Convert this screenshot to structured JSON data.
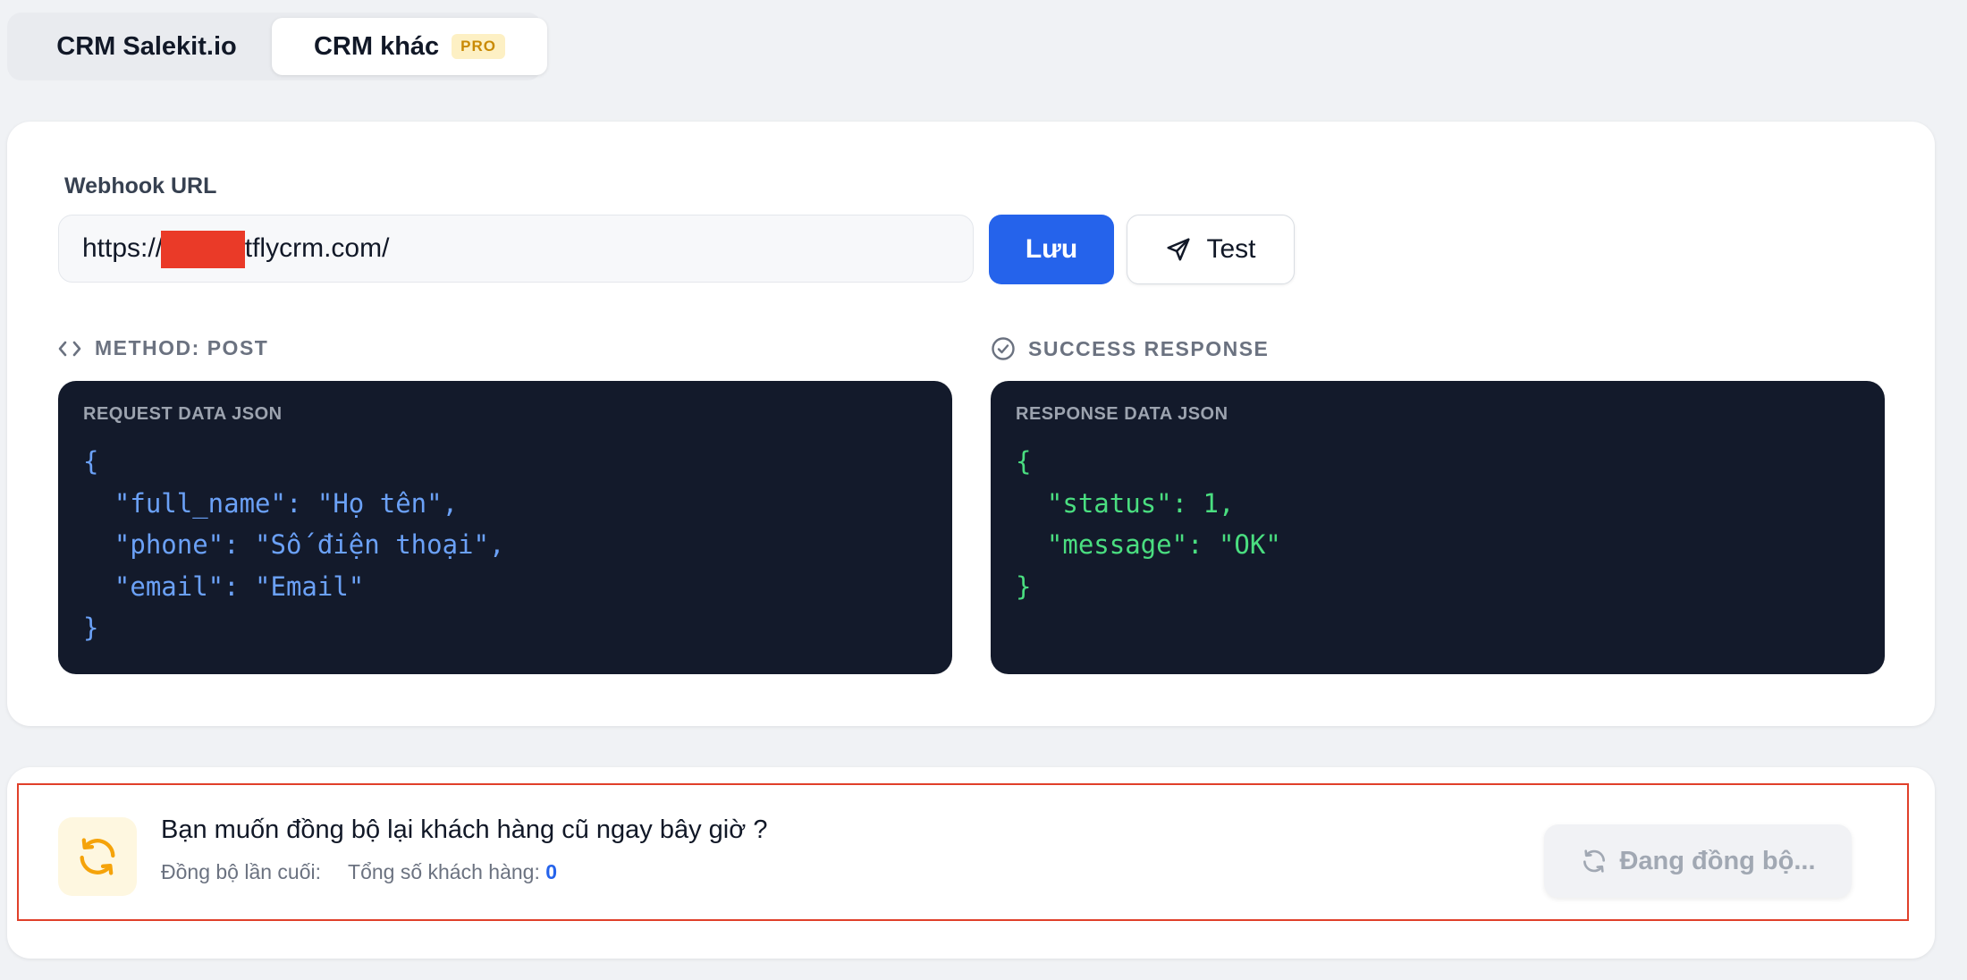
{
  "tabs": [
    {
      "label": "CRM Salekit.io",
      "active": false
    },
    {
      "label": "CRM khác",
      "badge": "PRO",
      "active": true
    }
  ],
  "webhook": {
    "label": "Webhook URL",
    "url_value": "https://       getflycrm.com/",
    "save_label": "Lưu",
    "test_label": "Test",
    "test_icon": "send-icon"
  },
  "method": {
    "icon": "code-icon",
    "label": "METHOD: POST",
    "code_title": "REQUEST DATA JSON",
    "code_lines": [
      "{",
      "  \"full_name\": \"Họ tên\",",
      "  \"phone\": \"Số điện thoại\",",
      "  \"email\": \"Email\"",
      "}"
    ]
  },
  "response": {
    "icon": "check-circle-icon",
    "label": "SUCCESS RESPONSE",
    "code_title": "RESPONSE DATA JSON",
    "code_lines": [
      "{",
      "  \"status\": 1,",
      "  \"message\": \"OK\"",
      "}"
    ]
  },
  "sync": {
    "icon": "refresh-icon",
    "question": "Bạn muốn đồng bộ lại khách hàng cũ ngay bây giờ ?",
    "last_sync_label": "Đồng bộ lần cuối:",
    "total_label": "Tổng số khách hàng:",
    "total_value": "0",
    "button_label": "Đang đồng bộ...",
    "button_icon": "refresh-icon"
  },
  "colors": {
    "accent": "#2563eb",
    "code_bg": "#131a2b",
    "request_code": "#6ba1f7",
    "response_code": "#4ade80",
    "pro_badge_bg": "#fdf0c4",
    "pro_badge_text": "#c98a04",
    "sync_icon": "#f5a30a",
    "highlight_border": "#e0402a"
  }
}
